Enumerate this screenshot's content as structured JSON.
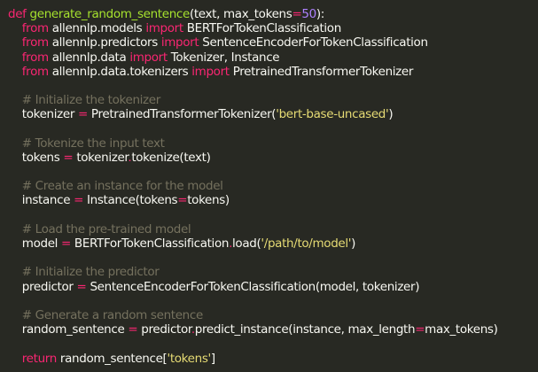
{
  "editor": {
    "language": "python",
    "theme_colors": {
      "background": "#282923",
      "text": "#f8f8f2",
      "keyword": "#f92672",
      "function": "#a6e22e",
      "number": "#ae81ff",
      "string": "#e6db74",
      "comment": "#75715e",
      "operator": "#f92672"
    },
    "lines": [
      [
        {
          "t": "kw",
          "v": "def"
        },
        {
          "t": "txt",
          "v": " "
        },
        {
          "t": "fn",
          "v": "generate_random_sentence"
        },
        {
          "t": "txt",
          "v": "(text, max_tokens"
        },
        {
          "t": "op",
          "v": "="
        },
        {
          "t": "num",
          "v": "50"
        },
        {
          "t": "txt",
          "v": "):"
        }
      ],
      [
        {
          "t": "txt",
          "v": "    "
        },
        {
          "t": "kw",
          "v": "from"
        },
        {
          "t": "txt",
          "v": " allennlp.models "
        },
        {
          "t": "kw",
          "v": "import"
        },
        {
          "t": "txt",
          "v": " BERTForTokenClassification"
        }
      ],
      [
        {
          "t": "txt",
          "v": "    "
        },
        {
          "t": "kw",
          "v": "from"
        },
        {
          "t": "txt",
          "v": " allennlp.predictors "
        },
        {
          "t": "kw",
          "v": "import"
        },
        {
          "t": "txt",
          "v": " SentenceEncoderForTokenClassification"
        }
      ],
      [
        {
          "t": "txt",
          "v": "    "
        },
        {
          "t": "kw",
          "v": "from"
        },
        {
          "t": "txt",
          "v": " allennlp.data "
        },
        {
          "t": "kw",
          "v": "import"
        },
        {
          "t": "txt",
          "v": " Tokenizer, Instance"
        }
      ],
      [
        {
          "t": "txt",
          "v": "    "
        },
        {
          "t": "kw",
          "v": "from"
        },
        {
          "t": "txt",
          "v": " allennlp.data.tokenizers "
        },
        {
          "t": "kw",
          "v": "import"
        },
        {
          "t": "txt",
          "v": " PretrainedTransformerTokenizer"
        }
      ],
      [],
      [
        {
          "t": "txt",
          "v": "    "
        },
        {
          "t": "cmt",
          "v": "# Initialize the tokenizer"
        }
      ],
      [
        {
          "t": "txt",
          "v": "    tokenizer "
        },
        {
          "t": "op",
          "v": "="
        },
        {
          "t": "txt",
          "v": " PretrainedTransformerTokenizer("
        },
        {
          "t": "str",
          "v": "'bert-base-uncased'"
        },
        {
          "t": "txt",
          "v": ")"
        }
      ],
      [],
      [
        {
          "t": "txt",
          "v": "    "
        },
        {
          "t": "cmt",
          "v": "# Tokenize the input text"
        }
      ],
      [
        {
          "t": "txt",
          "v": "    tokens "
        },
        {
          "t": "op",
          "v": "="
        },
        {
          "t": "txt",
          "v": " tokenizer"
        },
        {
          "t": "op",
          "v": "."
        },
        {
          "t": "txt",
          "v": "tokenize(text)"
        }
      ],
      [],
      [
        {
          "t": "txt",
          "v": "    "
        },
        {
          "t": "cmt",
          "v": "# Create an instance for the model"
        }
      ],
      [
        {
          "t": "txt",
          "v": "    instance "
        },
        {
          "t": "op",
          "v": "="
        },
        {
          "t": "txt",
          "v": " Instance(tokens"
        },
        {
          "t": "op",
          "v": "="
        },
        {
          "t": "txt",
          "v": "tokens)"
        }
      ],
      [],
      [
        {
          "t": "txt",
          "v": "    "
        },
        {
          "t": "cmt",
          "v": "# Load the pre-trained model"
        }
      ],
      [
        {
          "t": "txt",
          "v": "    model "
        },
        {
          "t": "op",
          "v": "="
        },
        {
          "t": "txt",
          "v": " BERTForTokenClassification"
        },
        {
          "t": "op",
          "v": "."
        },
        {
          "t": "txt",
          "v": "load("
        },
        {
          "t": "str",
          "v": "'/path/to/model'"
        },
        {
          "t": "txt",
          "v": ")"
        }
      ],
      [],
      [
        {
          "t": "txt",
          "v": "    "
        },
        {
          "t": "cmt",
          "v": "# Initialize the predictor"
        }
      ],
      [
        {
          "t": "txt",
          "v": "    predictor "
        },
        {
          "t": "op",
          "v": "="
        },
        {
          "t": "txt",
          "v": " SentenceEncoderForTokenClassification(model, tokenizer)"
        }
      ],
      [],
      [
        {
          "t": "txt",
          "v": "    "
        },
        {
          "t": "cmt",
          "v": "# Generate a random sentence"
        }
      ],
      [
        {
          "t": "txt",
          "v": "    random_sentence "
        },
        {
          "t": "op",
          "v": "="
        },
        {
          "t": "txt",
          "v": " predictor"
        },
        {
          "t": "op",
          "v": "."
        },
        {
          "t": "txt",
          "v": "predict_instance(instance, max_length"
        },
        {
          "t": "op",
          "v": "="
        },
        {
          "t": "txt",
          "v": "max_tokens)"
        }
      ],
      [],
      [
        {
          "t": "txt",
          "v": "    "
        },
        {
          "t": "kw",
          "v": "return"
        },
        {
          "t": "txt",
          "v": " random_sentence["
        },
        {
          "t": "str",
          "v": "'tokens'"
        },
        {
          "t": "txt",
          "v": "]"
        }
      ]
    ]
  }
}
